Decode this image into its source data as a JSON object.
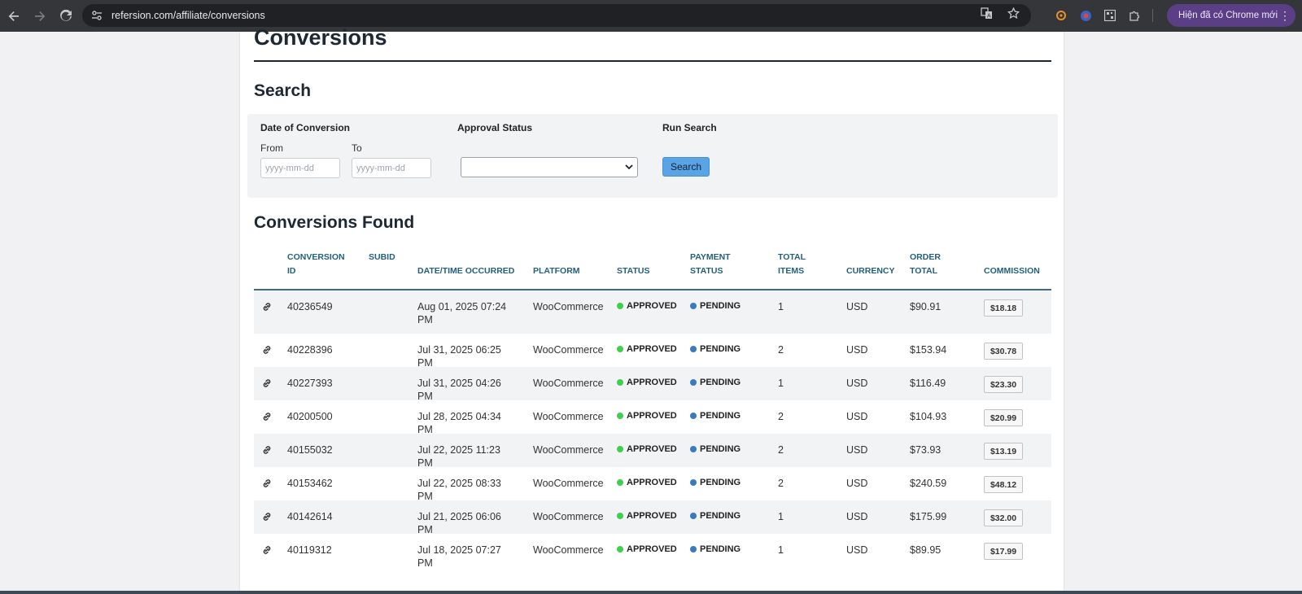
{
  "browser": {
    "url": "refersion.com/affiliate/conversions",
    "chrome_new_label": "Hiện đã có Chrome mới",
    "omnibox_bg": "#202124",
    "bar_bg": "#35363a"
  },
  "page": {
    "title": "Conversions",
    "search_title": "Search",
    "found_title": "Conversions Found"
  },
  "search": {
    "date_label": "Date of Conversion",
    "from_label": "From",
    "to_label": "To",
    "from_placeholder": "yyyy-mm-dd",
    "to_placeholder": "yyyy-mm-dd",
    "approval_label": "Approval Status",
    "approval_value": "",
    "run_label": "Run Search",
    "button_label": "Search",
    "button_color": "#5aa4e6"
  },
  "table": {
    "headers": {
      "conversion_id": "CONVERSION ID",
      "subid": "SUBID",
      "datetime": "DATE/TIME OCCURRED",
      "platform": "PLATFORM",
      "status": "STATUS",
      "payment_status": "PAYMENT STATUS",
      "total_items": "TOTAL ITEMS",
      "currency": "CURRENCY",
      "order_total": "ORDER TOTAL",
      "commission": "COMMISSION"
    },
    "rows": [
      {
        "id": "40236549",
        "subid": "",
        "datetime": "Aug 01, 2025 07:24 PM",
        "platform": "WooCommerce",
        "status": "APPROVED",
        "payment": "PENDING",
        "items": "1",
        "currency": "USD",
        "total": "$90.91",
        "commission": "$18.18"
      },
      {
        "id": "40228396",
        "subid": "",
        "datetime": "Jul 31, 2025 06:25 PM",
        "platform": "WooCommerce",
        "status": "APPROVED",
        "payment": "PENDING",
        "items": "2",
        "currency": "USD",
        "total": "$153.94",
        "commission": "$30.78"
      },
      {
        "id": "40227393",
        "subid": "",
        "datetime": "Jul 31, 2025 04:26 PM",
        "platform": "WooCommerce",
        "status": "APPROVED",
        "payment": "PENDING",
        "items": "1",
        "currency": "USD",
        "total": "$116.49",
        "commission": "$23.30"
      },
      {
        "id": "40200500",
        "subid": "",
        "datetime": "Jul 28, 2025 04:34 PM",
        "platform": "WooCommerce",
        "status": "APPROVED",
        "payment": "PENDING",
        "items": "2",
        "currency": "USD",
        "total": "$104.93",
        "commission": "$20.99"
      },
      {
        "id": "40155032",
        "subid": "",
        "datetime": "Jul 22, 2025 11:23 PM",
        "platform": "WooCommerce",
        "status": "APPROVED",
        "payment": "PENDING",
        "items": "2",
        "currency": "USD",
        "total": "$73.93",
        "commission": "$13.19"
      },
      {
        "id": "40153462",
        "subid": "",
        "datetime": "Jul 22, 2025 08:33 PM",
        "platform": "WooCommerce",
        "status": "APPROVED",
        "payment": "PENDING",
        "items": "2",
        "currency": "USD",
        "total": "$240.59",
        "commission": "$48.12"
      },
      {
        "id": "40142614",
        "subid": "",
        "datetime": "Jul 21, 2025 06:06 PM",
        "platform": "WooCommerce",
        "status": "APPROVED",
        "payment": "PENDING",
        "items": "1",
        "currency": "USD",
        "total": "$175.99",
        "commission": "$32.00"
      },
      {
        "id": "40119312",
        "subid": "",
        "datetime": "Jul 18, 2025 07:27 PM",
        "platform": "WooCommerce",
        "status": "APPROVED",
        "payment": "PENDING",
        "items": "1",
        "currency": "USD",
        "total": "$89.95",
        "commission": "$17.99"
      }
    ],
    "approved_color": "#3fcf4f",
    "pending_color": "#3b79c1",
    "header_color": "#23607a"
  }
}
